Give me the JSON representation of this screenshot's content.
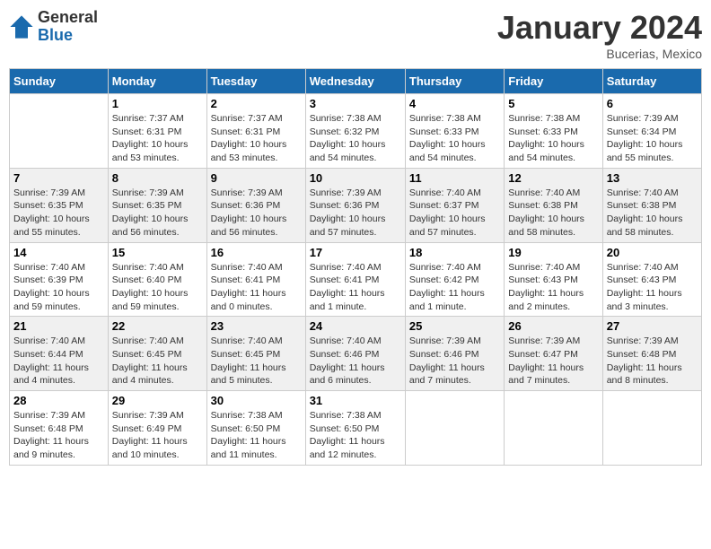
{
  "logo": {
    "general": "General",
    "blue": "Blue"
  },
  "title": "January 2024",
  "location": "Bucerias, Mexico",
  "days_header": [
    "Sunday",
    "Monday",
    "Tuesday",
    "Wednesday",
    "Thursday",
    "Friday",
    "Saturday"
  ],
  "weeks": [
    [
      {
        "day": "",
        "sunrise": "",
        "sunset": "",
        "daylight": ""
      },
      {
        "day": "1",
        "sunrise": "Sunrise: 7:37 AM",
        "sunset": "Sunset: 6:31 PM",
        "daylight": "Daylight: 10 hours and 53 minutes."
      },
      {
        "day": "2",
        "sunrise": "Sunrise: 7:37 AM",
        "sunset": "Sunset: 6:31 PM",
        "daylight": "Daylight: 10 hours and 53 minutes."
      },
      {
        "day": "3",
        "sunrise": "Sunrise: 7:38 AM",
        "sunset": "Sunset: 6:32 PM",
        "daylight": "Daylight: 10 hours and 54 minutes."
      },
      {
        "day": "4",
        "sunrise": "Sunrise: 7:38 AM",
        "sunset": "Sunset: 6:33 PM",
        "daylight": "Daylight: 10 hours and 54 minutes."
      },
      {
        "day": "5",
        "sunrise": "Sunrise: 7:38 AM",
        "sunset": "Sunset: 6:33 PM",
        "daylight": "Daylight: 10 hours and 54 minutes."
      },
      {
        "day": "6",
        "sunrise": "Sunrise: 7:39 AM",
        "sunset": "Sunset: 6:34 PM",
        "daylight": "Daylight: 10 hours and 55 minutes."
      }
    ],
    [
      {
        "day": "7",
        "sunrise": "Sunrise: 7:39 AM",
        "sunset": "Sunset: 6:35 PM",
        "daylight": "Daylight: 10 hours and 55 minutes."
      },
      {
        "day": "8",
        "sunrise": "Sunrise: 7:39 AM",
        "sunset": "Sunset: 6:35 PM",
        "daylight": "Daylight: 10 hours and 56 minutes."
      },
      {
        "day": "9",
        "sunrise": "Sunrise: 7:39 AM",
        "sunset": "Sunset: 6:36 PM",
        "daylight": "Daylight: 10 hours and 56 minutes."
      },
      {
        "day": "10",
        "sunrise": "Sunrise: 7:39 AM",
        "sunset": "Sunset: 6:36 PM",
        "daylight": "Daylight: 10 hours and 57 minutes."
      },
      {
        "day": "11",
        "sunrise": "Sunrise: 7:40 AM",
        "sunset": "Sunset: 6:37 PM",
        "daylight": "Daylight: 10 hours and 57 minutes."
      },
      {
        "day": "12",
        "sunrise": "Sunrise: 7:40 AM",
        "sunset": "Sunset: 6:38 PM",
        "daylight": "Daylight: 10 hours and 58 minutes."
      },
      {
        "day": "13",
        "sunrise": "Sunrise: 7:40 AM",
        "sunset": "Sunset: 6:38 PM",
        "daylight": "Daylight: 10 hours and 58 minutes."
      }
    ],
    [
      {
        "day": "14",
        "sunrise": "Sunrise: 7:40 AM",
        "sunset": "Sunset: 6:39 PM",
        "daylight": "Daylight: 10 hours and 59 minutes."
      },
      {
        "day": "15",
        "sunrise": "Sunrise: 7:40 AM",
        "sunset": "Sunset: 6:40 PM",
        "daylight": "Daylight: 10 hours and 59 minutes."
      },
      {
        "day": "16",
        "sunrise": "Sunrise: 7:40 AM",
        "sunset": "Sunset: 6:41 PM",
        "daylight": "Daylight: 11 hours and 0 minutes."
      },
      {
        "day": "17",
        "sunrise": "Sunrise: 7:40 AM",
        "sunset": "Sunset: 6:41 PM",
        "daylight": "Daylight: 11 hours and 1 minute."
      },
      {
        "day": "18",
        "sunrise": "Sunrise: 7:40 AM",
        "sunset": "Sunset: 6:42 PM",
        "daylight": "Daylight: 11 hours and 1 minute."
      },
      {
        "day": "19",
        "sunrise": "Sunrise: 7:40 AM",
        "sunset": "Sunset: 6:43 PM",
        "daylight": "Daylight: 11 hours and 2 minutes."
      },
      {
        "day": "20",
        "sunrise": "Sunrise: 7:40 AM",
        "sunset": "Sunset: 6:43 PM",
        "daylight": "Daylight: 11 hours and 3 minutes."
      }
    ],
    [
      {
        "day": "21",
        "sunrise": "Sunrise: 7:40 AM",
        "sunset": "Sunset: 6:44 PM",
        "daylight": "Daylight: 11 hours and 4 minutes."
      },
      {
        "day": "22",
        "sunrise": "Sunrise: 7:40 AM",
        "sunset": "Sunset: 6:45 PM",
        "daylight": "Daylight: 11 hours and 4 minutes."
      },
      {
        "day": "23",
        "sunrise": "Sunrise: 7:40 AM",
        "sunset": "Sunset: 6:45 PM",
        "daylight": "Daylight: 11 hours and 5 minutes."
      },
      {
        "day": "24",
        "sunrise": "Sunrise: 7:40 AM",
        "sunset": "Sunset: 6:46 PM",
        "daylight": "Daylight: 11 hours and 6 minutes."
      },
      {
        "day": "25",
        "sunrise": "Sunrise: 7:39 AM",
        "sunset": "Sunset: 6:46 PM",
        "daylight": "Daylight: 11 hours and 7 minutes."
      },
      {
        "day": "26",
        "sunrise": "Sunrise: 7:39 AM",
        "sunset": "Sunset: 6:47 PM",
        "daylight": "Daylight: 11 hours and 7 minutes."
      },
      {
        "day": "27",
        "sunrise": "Sunrise: 7:39 AM",
        "sunset": "Sunset: 6:48 PM",
        "daylight": "Daylight: 11 hours and 8 minutes."
      }
    ],
    [
      {
        "day": "28",
        "sunrise": "Sunrise: 7:39 AM",
        "sunset": "Sunset: 6:48 PM",
        "daylight": "Daylight: 11 hours and 9 minutes."
      },
      {
        "day": "29",
        "sunrise": "Sunrise: 7:39 AM",
        "sunset": "Sunset: 6:49 PM",
        "daylight": "Daylight: 11 hours and 10 minutes."
      },
      {
        "day": "30",
        "sunrise": "Sunrise: 7:38 AM",
        "sunset": "Sunset: 6:50 PM",
        "daylight": "Daylight: 11 hours and 11 minutes."
      },
      {
        "day": "31",
        "sunrise": "Sunrise: 7:38 AM",
        "sunset": "Sunset: 6:50 PM",
        "daylight": "Daylight: 11 hours and 12 minutes."
      },
      {
        "day": "",
        "sunrise": "",
        "sunset": "",
        "daylight": ""
      },
      {
        "day": "",
        "sunrise": "",
        "sunset": "",
        "daylight": ""
      },
      {
        "day": "",
        "sunrise": "",
        "sunset": "",
        "daylight": ""
      }
    ]
  ]
}
